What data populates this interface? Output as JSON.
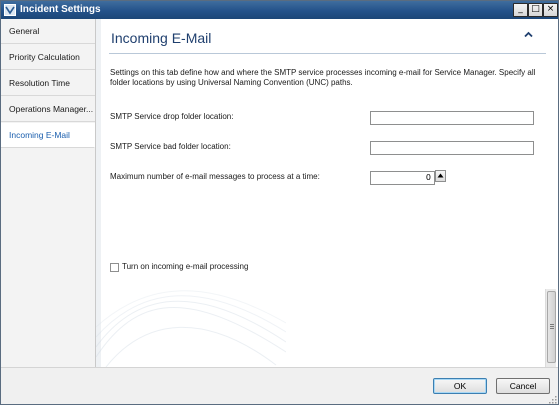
{
  "window": {
    "title": "Incident Settings",
    "minimize_glyph": "_",
    "maximize_glyph": "□",
    "close_glyph": "×"
  },
  "nav": {
    "items": [
      {
        "label": "General",
        "selected": false
      },
      {
        "label": "Priority Calculation",
        "selected": false
      },
      {
        "label": "Resolution Time",
        "selected": false
      },
      {
        "label": "Operations Manager...",
        "selected": false
      },
      {
        "label": "Incoming E-Mail",
        "selected": true
      }
    ]
  },
  "section": {
    "title": "Incoming E-Mail",
    "collapse_icon": "chevron-up",
    "description": "Settings on this tab define how and where the SMTP service processes incoming e-mail for Service Manager. Specify all folder locations by using Universal Naming Convention (UNC) paths."
  },
  "fields": {
    "drop_folder": {
      "label": "SMTP Service drop folder location:",
      "value": ""
    },
    "bad_folder": {
      "label": "SMTP Service bad folder location:",
      "value": ""
    },
    "max_messages": {
      "label": "Maximum number of e-mail messages to process at a time:",
      "value": "0"
    }
  },
  "checkbox": {
    "label": "Turn on incoming e-mail processing",
    "checked": false
  },
  "footer": {
    "ok_label": "OK",
    "cancel_label": "Cancel"
  },
  "colors": {
    "titlebar": "#24528a",
    "section_title": "#1f3f6e",
    "selected_nav": "#1b5fae"
  }
}
